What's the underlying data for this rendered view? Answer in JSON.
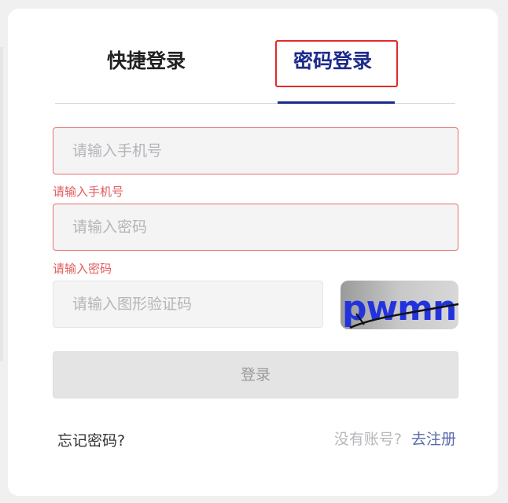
{
  "tabs": {
    "quick_login": "快捷登录",
    "password_login": "密码登录"
  },
  "form": {
    "phone": {
      "placeholder": "请输入手机号",
      "value": "",
      "error": "请输入手机号"
    },
    "password": {
      "placeholder": "请输入密码",
      "value": "",
      "error": "请输入密码"
    },
    "captcha": {
      "placeholder": "请输入图形验证码",
      "value": "",
      "image_text": "pwmn"
    },
    "login_button": "登录"
  },
  "footer": {
    "forgot_password": "忘记密码?",
    "no_account": "没有账号?",
    "register": "去注册"
  },
  "colors": {
    "accent": "#1c2a8c",
    "error": "#e05b5b",
    "highlight_box": "#e12a2a",
    "captcha_text": "#2233dd"
  }
}
